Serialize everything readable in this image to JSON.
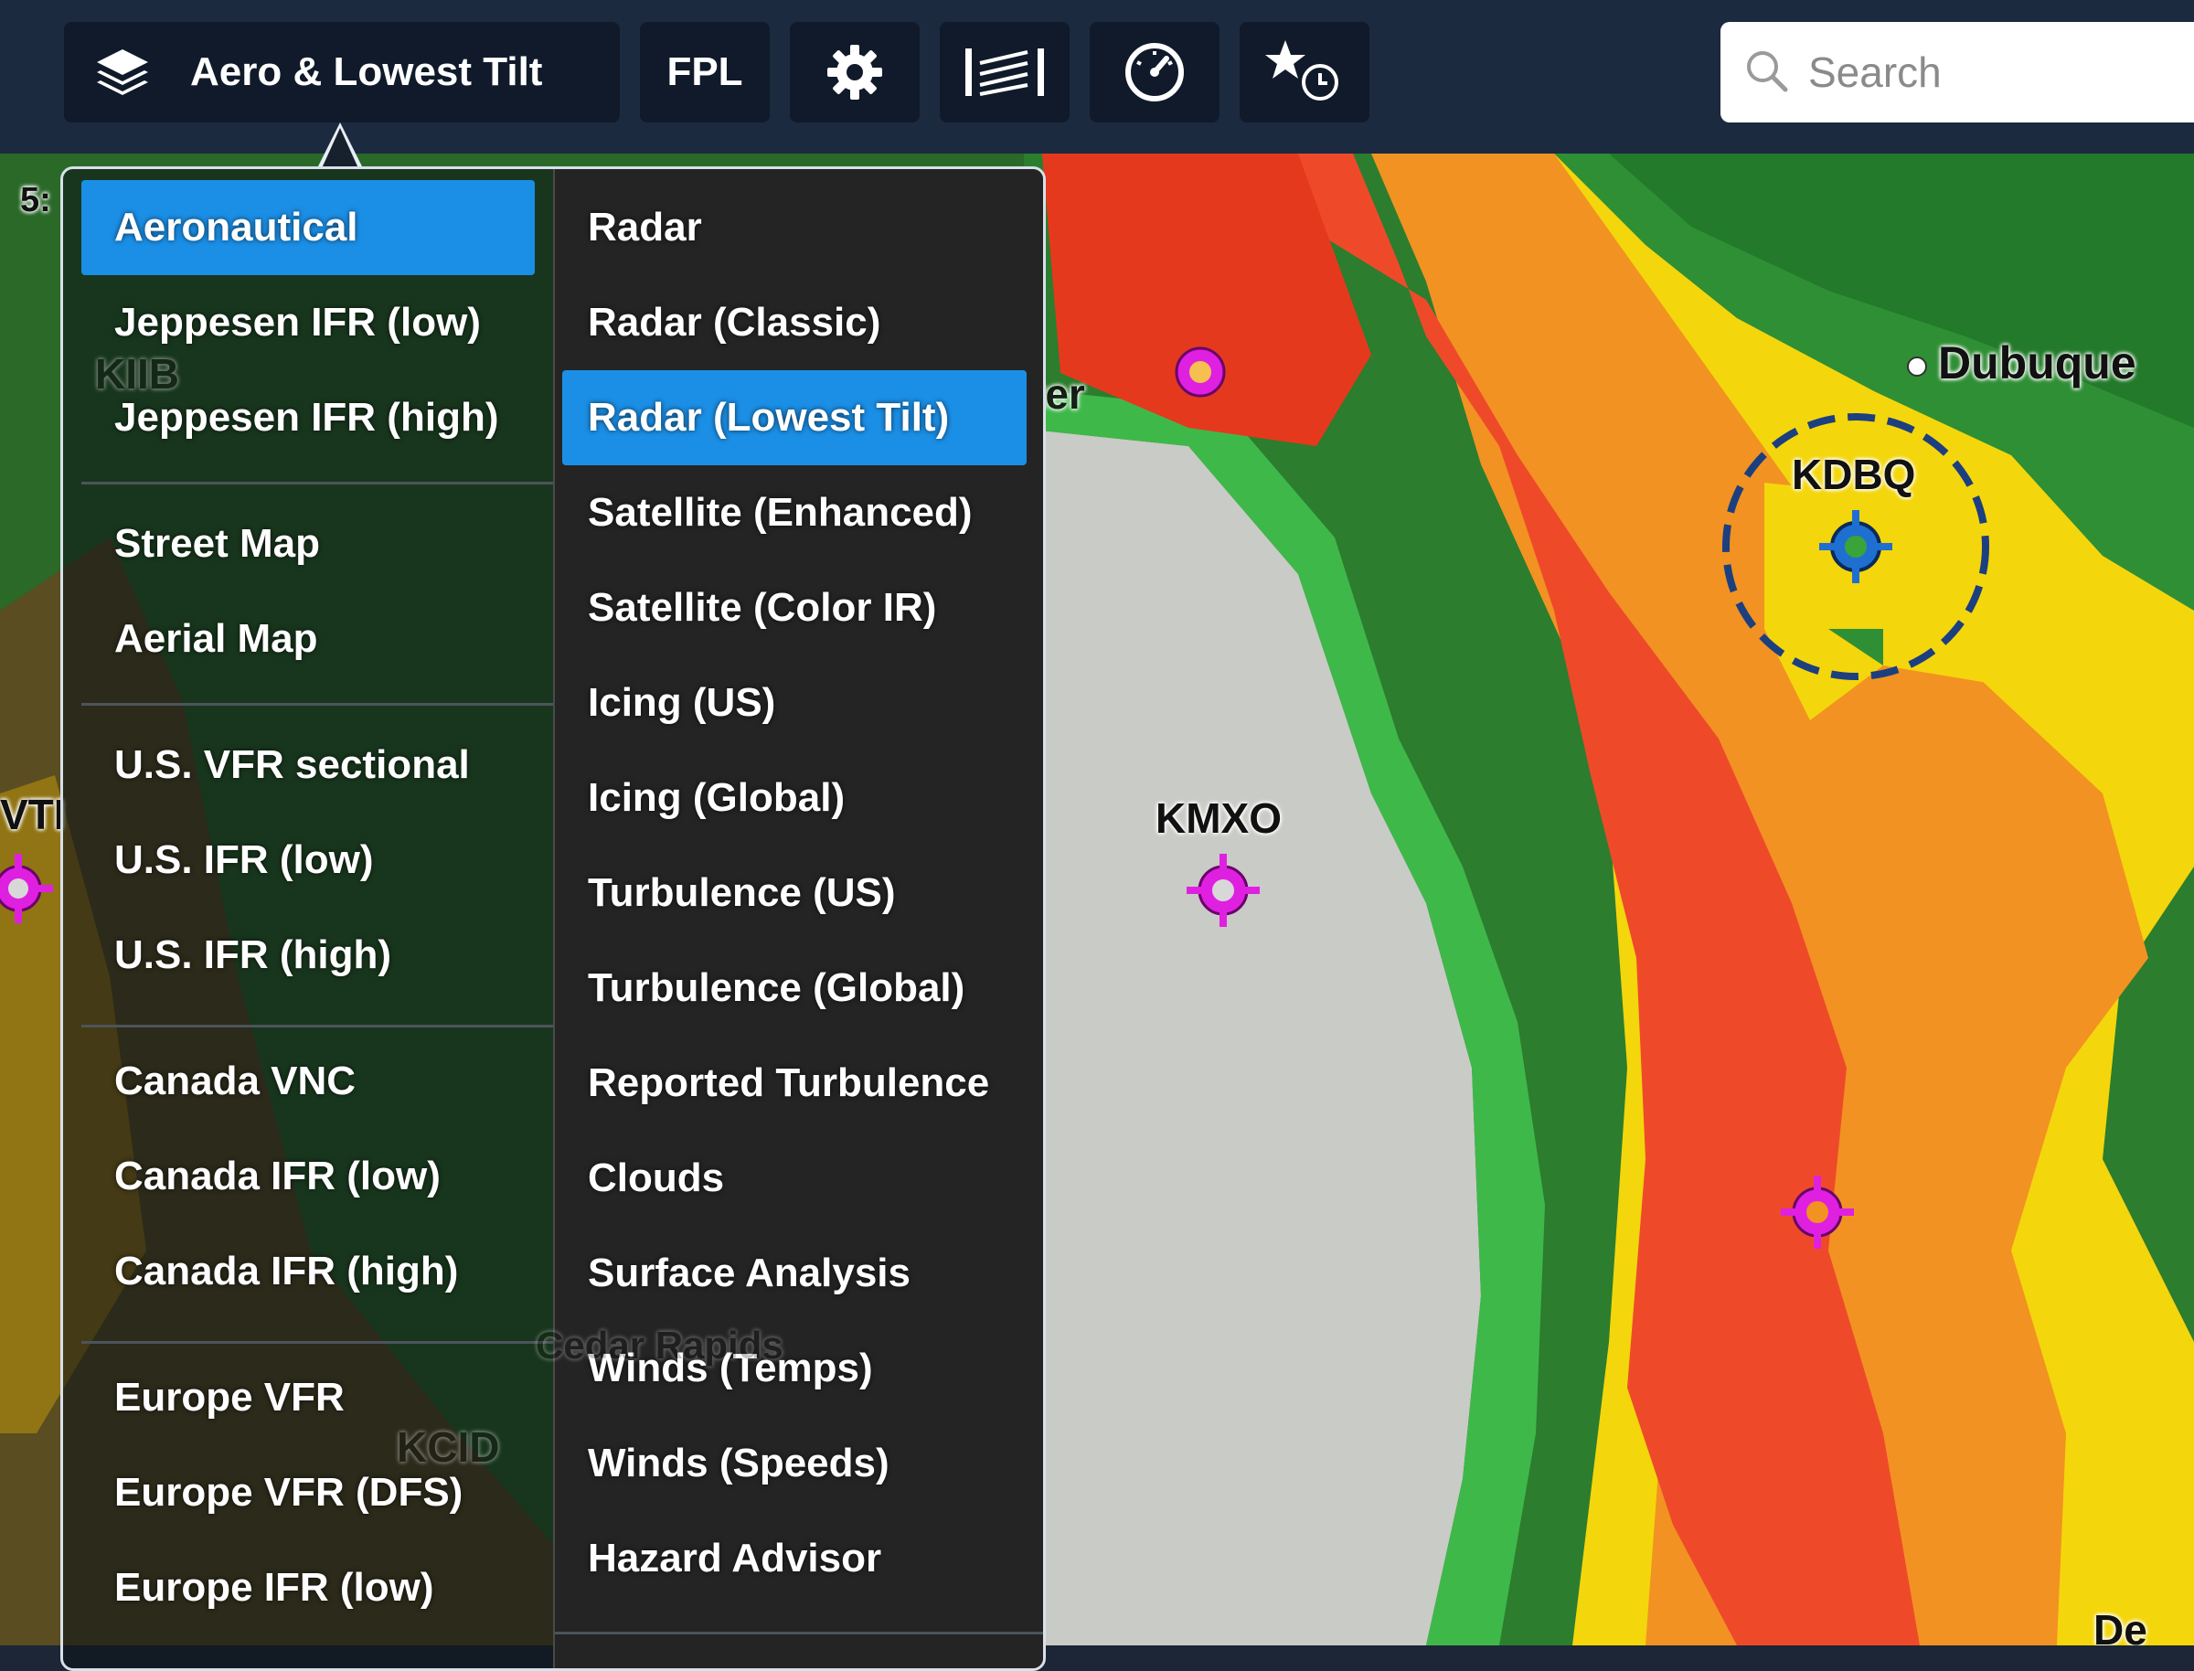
{
  "toolbar": {
    "layers_label": "Aero & Lowest Tilt",
    "fpl_label": "FPL",
    "search_placeholder": "Search"
  },
  "map": {
    "scale_text": "5:",
    "labels": {
      "dubuque": "Dubuque",
      "kdbq": "KDBQ",
      "kmxo": "KMXO",
      "kiib": "KIIB",
      "vti": "VTI",
      "kcid": "KCID",
      "cedar_rapids": "Cedar Rapids",
      "ter": "ter",
      "dev": "De"
    }
  },
  "base_layers": [
    {
      "label": "Aeronautical",
      "selected": true
    },
    {
      "label": "Jeppesen IFR (low)"
    },
    {
      "label": "Jeppesen IFR (high)"
    },
    {
      "label": "Street Map"
    },
    {
      "label": "Aerial Map"
    },
    {
      "label": "U.S. VFR sectional"
    },
    {
      "label": "U.S. IFR (low)"
    },
    {
      "label": "U.S. IFR (high)"
    },
    {
      "label": "Canada VNC"
    },
    {
      "label": "Canada IFR (low)"
    },
    {
      "label": "Canada IFR (high)"
    },
    {
      "label": "Europe VFR"
    },
    {
      "label": "Europe VFR (DFS)"
    },
    {
      "label": "Europe IFR (low)"
    }
  ],
  "overlay_layers": [
    {
      "label": "Radar"
    },
    {
      "label": "Radar (Classic)"
    },
    {
      "label": "Radar (Lowest Tilt)",
      "selected": true
    },
    {
      "label": "Satellite (Enhanced)"
    },
    {
      "label": "Satellite (Color IR)"
    },
    {
      "label": "Icing (US)"
    },
    {
      "label": "Icing (Global)"
    },
    {
      "label": "Turbulence (US)"
    },
    {
      "label": "Turbulence (Global)"
    },
    {
      "label": "Reported Turbulence"
    },
    {
      "label": "Clouds"
    },
    {
      "label": "Surface Analysis"
    },
    {
      "label": "Winds (Temps)"
    },
    {
      "label": "Winds (Speeds)"
    },
    {
      "label": "Hazard Advisor"
    }
  ],
  "colors": {
    "selected_bg": "#1b8fe6",
    "airport_magenta": "#e020e0",
    "airport_blue": "#1f6fd0"
  }
}
